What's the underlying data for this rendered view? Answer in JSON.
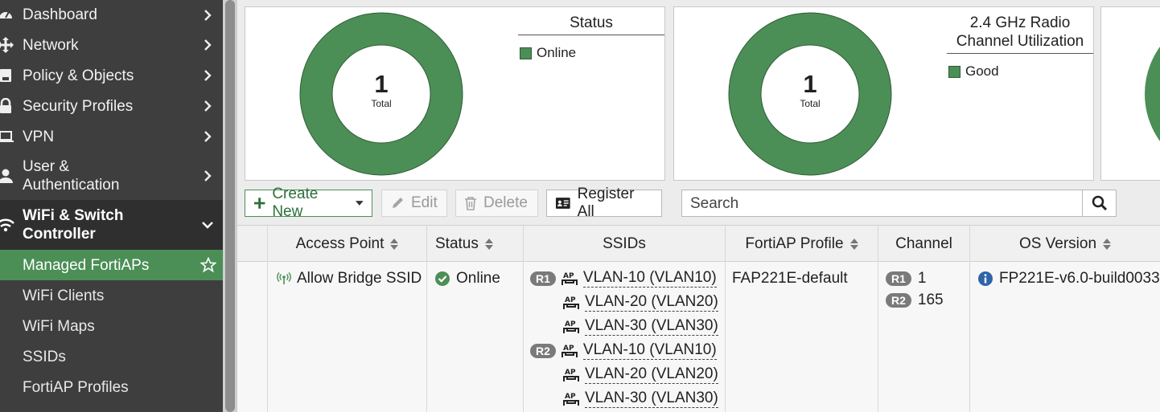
{
  "sidebar": {
    "items": [
      {
        "label": "Dashboard",
        "icon": "dashboard-icon"
      },
      {
        "label": "Network",
        "icon": "network-icon"
      },
      {
        "label": "Policy & Objects",
        "icon": "policy-icon"
      },
      {
        "label": "Security Profiles",
        "icon": "lock-icon"
      },
      {
        "label": "VPN",
        "icon": "laptop-icon"
      },
      {
        "label_1": "User &",
        "label_2": "Authentication",
        "icon": "user-icon"
      },
      {
        "label_1": "WiFi & Switch",
        "label_2": "Controller",
        "icon": "wifi-icon"
      }
    ],
    "sub_items": [
      "Managed FortiAPs",
      "WiFi Clients",
      "WiFi Maps",
      "SSIDs",
      "FortiAP Profiles"
    ]
  },
  "widgets": [
    {
      "title": "Status",
      "total": "1",
      "total_label": "Total",
      "legend": "Online"
    },
    {
      "title_1": "2.4 GHz Radio",
      "title_2": "Channel Utilization",
      "total": "1",
      "total_label": "Total",
      "legend": "Good"
    }
  ],
  "toolbar": {
    "create_new": "Create New",
    "edit": "Edit",
    "delete": "Delete",
    "register_all": "Register All",
    "search_placeholder": "Search"
  },
  "table": {
    "columns": [
      "Access Point",
      "Status",
      "SSIDs",
      "FortiAP Profile",
      "Channel",
      "OS Version"
    ],
    "row": {
      "access_point": "Allow Bridge SSID",
      "status": "Online",
      "radio_1": "R1",
      "radio_2": "R2",
      "ssids_r1": [
        "VLAN-10 (VLAN10)",
        "VLAN-20 (VLAN20)",
        "VLAN-30 (VLAN30)"
      ],
      "ssids_r2": [
        "VLAN-10 (VLAN10)",
        "VLAN-20 (VLAN20)",
        "VLAN-30 (VLAN30)"
      ],
      "profile": "FAP221E-default",
      "channel_r1": "1",
      "channel_r2": "165",
      "os_version": "FP221E-v6.0-build0033"
    }
  },
  "colors": {
    "accent": "#4b8f56",
    "sidebar": "#3e3e3e"
  }
}
